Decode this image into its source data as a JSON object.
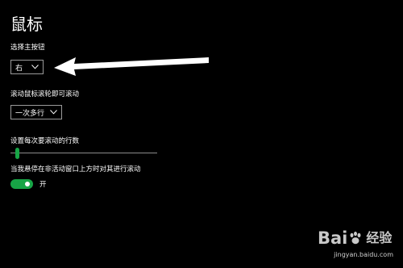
{
  "page": {
    "title": "鼠标"
  },
  "primary_button": {
    "label": "选择主按钮",
    "value": "右"
  },
  "scroll_mode": {
    "label": "滚动鼠标滚轮即可滚动",
    "value": "一次多行"
  },
  "scroll_lines": {
    "label": "设置每次要滚动的行数",
    "level_fraction": 0.02
  },
  "inactive_scroll": {
    "label": "当我悬停在非活动窗口上方时对其进行滚动",
    "state_text": "开",
    "on": true
  },
  "annotation": {
    "arrow_color": "#ffffff"
  },
  "watermark": {
    "brand_left": "Bai",
    "brand_right": "经验",
    "url": "jingyan.baidu.com"
  },
  "colors": {
    "background": "#000000",
    "accent": "#17a546"
  }
}
